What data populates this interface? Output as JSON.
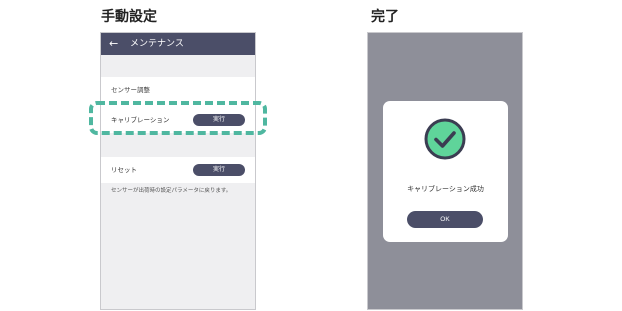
{
  "left_panel": {
    "caption": "手動設定",
    "appbar": {
      "back_glyph": "←",
      "title": "メンテナンス"
    },
    "sensor_section": {
      "label": "センサー調整",
      "row_label": "キャリブレーション",
      "button_label": "実行"
    },
    "reset_row": {
      "row_label": "リセット",
      "button_label": "実行"
    },
    "note": "センサーが出荷時の設定パラメータに戻ります。",
    "highlight_color": "#4fb7a0"
  },
  "right_panel": {
    "caption": "完了",
    "dialog": {
      "message": "キャリブレーション成功",
      "ok_label": "OK",
      "icon": "check-circle-icon",
      "icon_color": "#5fd49a"
    }
  },
  "colors": {
    "appbar": "#4b4e68",
    "button": "#4b4e68",
    "overlay": "#8e8f99",
    "screen_bg": "#efeff1"
  }
}
